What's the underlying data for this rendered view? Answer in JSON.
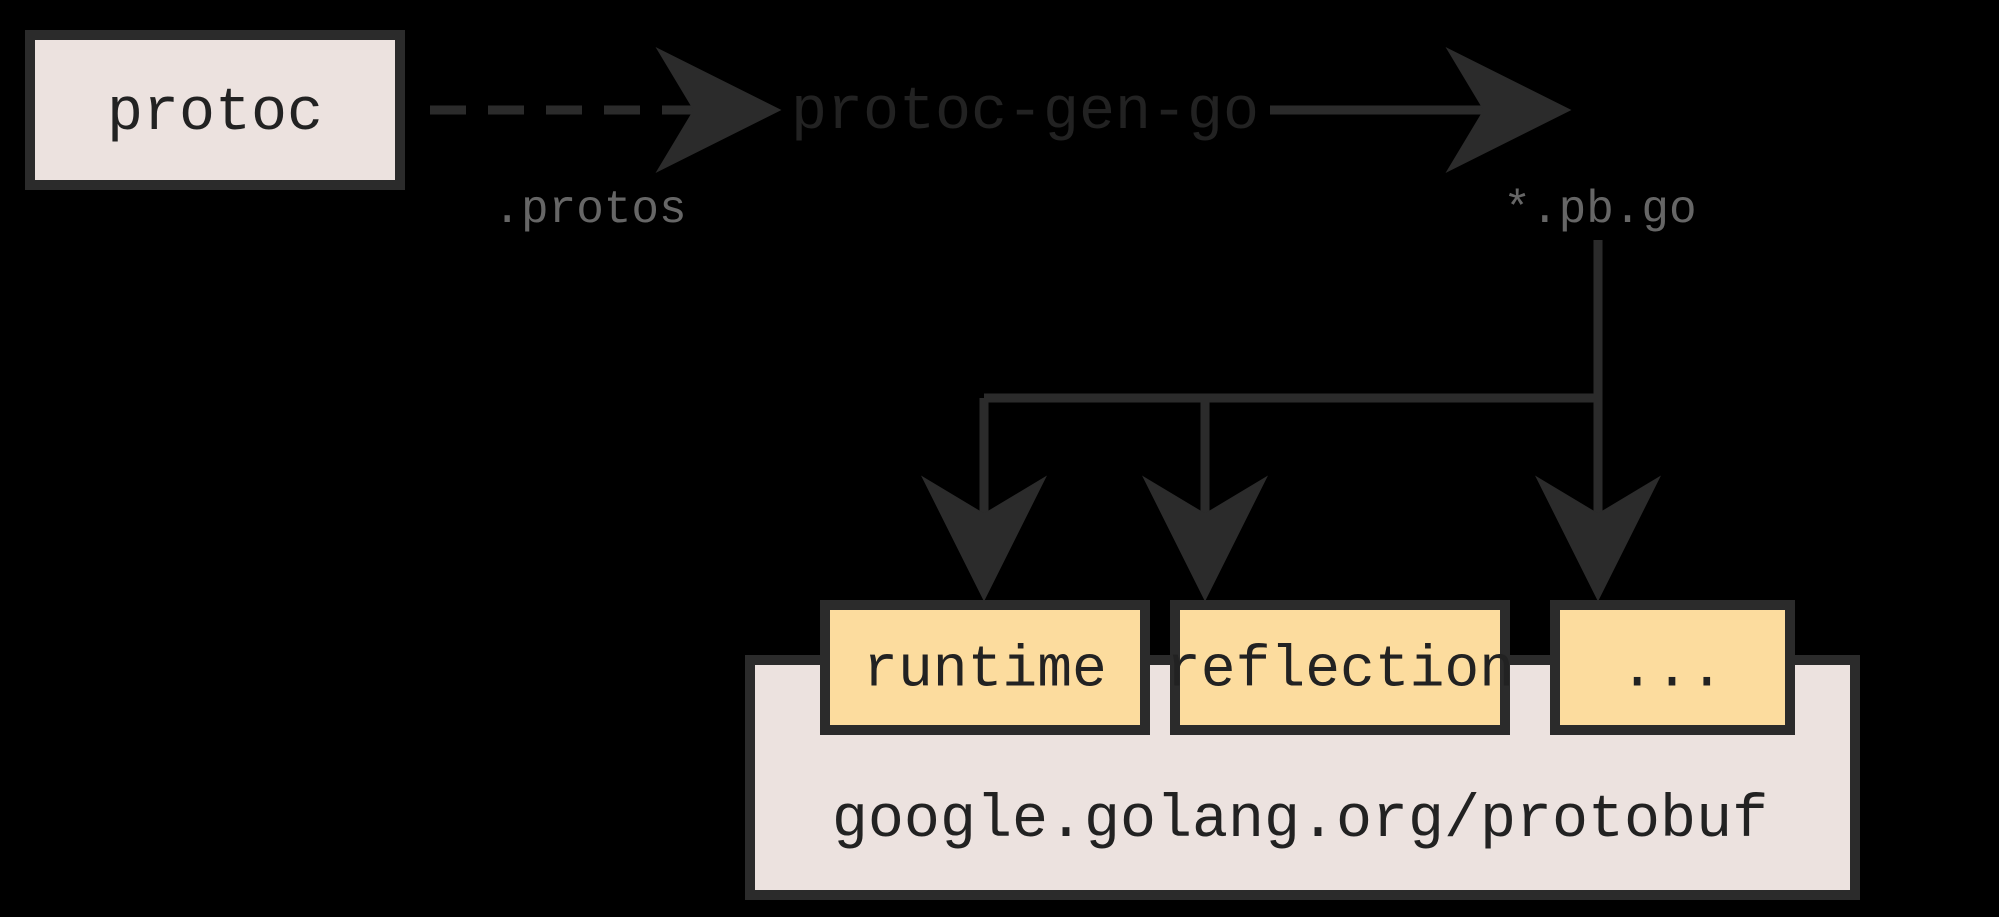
{
  "nodes": {
    "protoc": "protoc",
    "plugin": "protoc-gen-go",
    "runtime": "runtime",
    "reflection": "reflection",
    "more": "...",
    "module": "google.golang.org/protobuf"
  },
  "edges": {
    "protos_label": ".protos",
    "generated_label": "*.pb.go"
  }
}
